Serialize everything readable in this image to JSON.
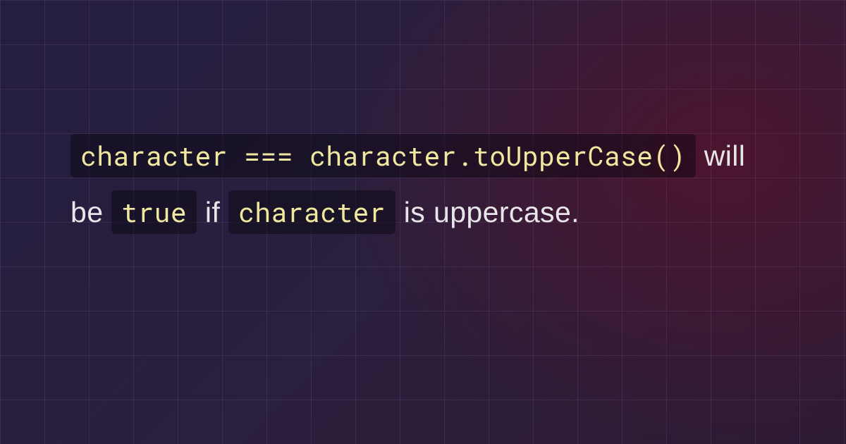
{
  "sentence": {
    "code1": "character === character.toUpperCase()",
    "text1": " will be ",
    "code2": "true",
    "text2": " if ",
    "code3": "character",
    "text3": " is uppercase."
  },
  "colors": {
    "code_text": "#f1e8a0",
    "body_text": "#e8e6ea",
    "code_bg": "rgba(5,3,12,0.42)"
  }
}
